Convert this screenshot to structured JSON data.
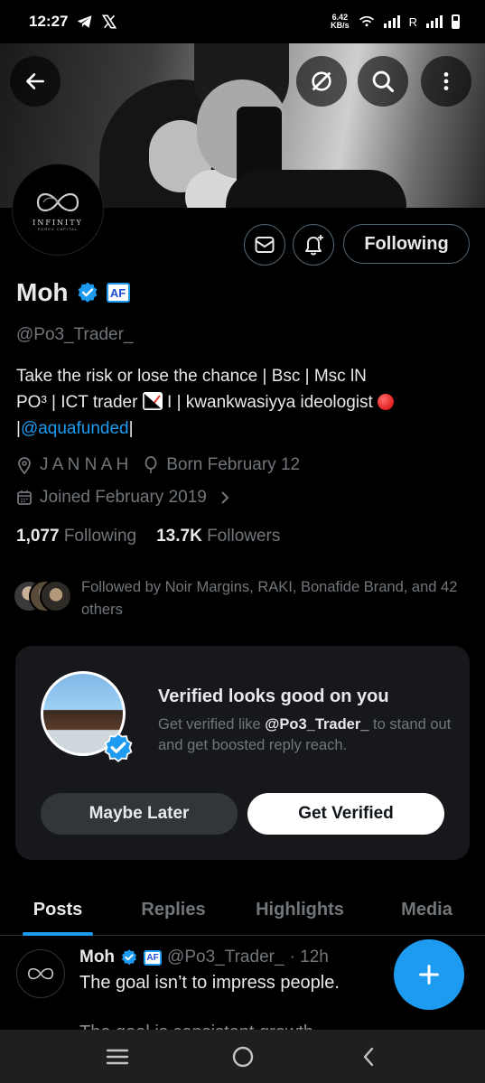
{
  "status_bar": {
    "time": "12:27",
    "net_speed_value": "6.42",
    "net_speed_unit": "KB/s",
    "roaming": "R"
  },
  "header": {
    "back_icon": "back-arrow-icon",
    "grok_icon": "grok-icon",
    "search_icon": "search-icon",
    "more_icon": "more-vertical-icon"
  },
  "avatar": {
    "text": "INFINITY",
    "sub": "FOREX CAPITAL"
  },
  "actions": {
    "message_icon": "message-icon",
    "notify_icon": "bell-plus-icon",
    "following_label": "Following"
  },
  "profile": {
    "name": "Moh",
    "af_badge": "AF",
    "handle": "@Po3_Trader_",
    "bio_line1": "Take the risk or lose the chance | Bsc | Msc lN",
    "bio_line2_a": "PO³  | ICT trader ",
    "bio_line2_b": " I | kwankwasiyya ideologist ",
    "bio_line3_a": "|",
    "bio_link": "@aquafunded",
    "bio_line3_b": "|",
    "location": "J A N N A H",
    "birthday": "Born February 12",
    "joined": "Joined February 2019",
    "following_count": "1,077",
    "following_label": "Following",
    "followers_count": "13.7K",
    "followers_label": "Followers",
    "followed_by": "Followed by Noir Margins, RAKI, Bonafide Brand, and 42 others"
  },
  "promo": {
    "title": "Verified looks good on you",
    "desc_a": "Get verified like ",
    "desc_handle": "@Po3_Trader_",
    "desc_b": " to stand out and get boosted reply reach.",
    "maybe_label": "Maybe Later",
    "verify_label": "Get Verified"
  },
  "tabs": [
    {
      "label": "Posts",
      "active": true
    },
    {
      "label": "Replies",
      "active": false
    },
    {
      "label": "Highlights",
      "active": false
    },
    {
      "label": "Media",
      "active": false
    }
  ],
  "post": {
    "name": "Moh",
    "af_badge": "AF",
    "handle": "@Po3_Trader_",
    "time": "· 12h",
    "text": "The goal isn’t to impress people.",
    "text2": "The goal is consistent growth."
  },
  "fab": {
    "icon": "plus-icon"
  },
  "nav": {
    "menu_icon": "recents-icon",
    "home_icon": "home-icon",
    "back_icon": "nav-back-icon"
  },
  "colors": {
    "accent": "#1d9bf0",
    "background": "#000000",
    "muted": "#71767b",
    "card": "#16181c"
  }
}
